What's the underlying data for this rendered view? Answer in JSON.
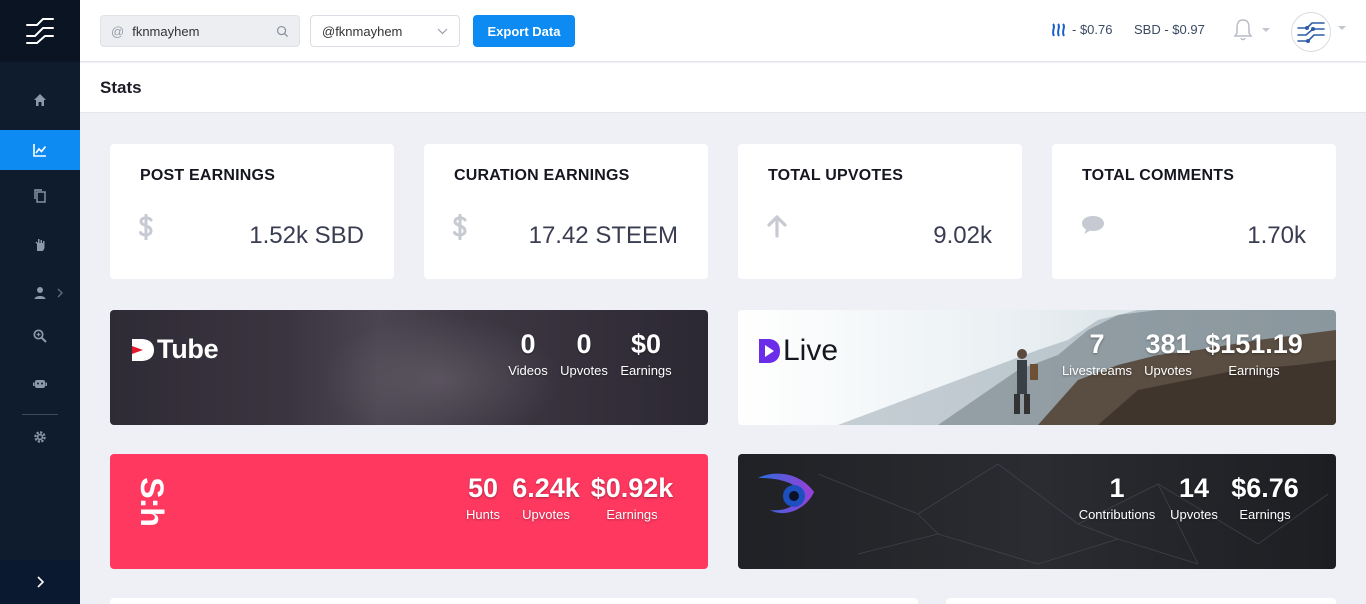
{
  "topbar": {
    "search": {
      "prefix": "@",
      "value": "fknmayhem"
    },
    "account_select": {
      "value": "@fknmayhem"
    },
    "export_label": "Export Data",
    "steem_price": "- $0.76",
    "sbd_price": "SBD - $0.97"
  },
  "sidebar": {
    "items": [
      {
        "icon": "home-icon"
      },
      {
        "icon": "chart-icon",
        "active": true
      },
      {
        "icon": "copy-icon"
      },
      {
        "icon": "hand-icon"
      },
      {
        "icon": "user-icon"
      },
      {
        "icon": "search-zoom-icon"
      },
      {
        "icon": "robot-icon"
      },
      {
        "icon": "gear-icon"
      }
    ]
  },
  "page": {
    "title": "Stats"
  },
  "stats": [
    {
      "label": "POST EARNINGS",
      "value": "1.52k SBD",
      "icon": "dollar-icon"
    },
    {
      "label": "CURATION EARNINGS",
      "value": "17.42 STEEM",
      "icon": "dollar-icon"
    },
    {
      "label": "TOTAL UPVOTES",
      "value": "9.02k",
      "icon": "arrow-up-icon"
    },
    {
      "label": "TOTAL COMMENTS",
      "value": "1.70k",
      "icon": "comment-icon"
    }
  ],
  "platforms": {
    "dtube": {
      "brand": "Tube",
      "metrics": [
        {
          "num": "0",
          "label": "Videos"
        },
        {
          "num": "0",
          "label": "Upvotes"
        },
        {
          "num": "$0",
          "label": "Earnings"
        }
      ]
    },
    "dlive": {
      "brand": "Live",
      "metrics": [
        {
          "num": "7",
          "label": "Livestreams"
        },
        {
          "num": "381",
          "label": "Upvotes"
        },
        {
          "num": "$151.19",
          "label": "Earnings"
        }
      ]
    },
    "steemhunt": {
      "brand": "S:h",
      "metrics": [
        {
          "num": "50",
          "label": "Hunts"
        },
        {
          "num": "6.24k",
          "label": "Upvotes"
        },
        {
          "num": "$0.92k",
          "label": "Earnings"
        }
      ]
    },
    "utopian": {
      "metrics": [
        {
          "num": "1",
          "label": "Contributions"
        },
        {
          "num": "14",
          "label": "Upvotes"
        },
        {
          "num": "$6.76",
          "label": "Earnings"
        }
      ]
    }
  },
  "colors": {
    "accent": "#0d8bf2",
    "sidebar": "#0e1c2e",
    "steemhunt": "#ff3860",
    "dlive_purple": "#6b2ee8"
  }
}
